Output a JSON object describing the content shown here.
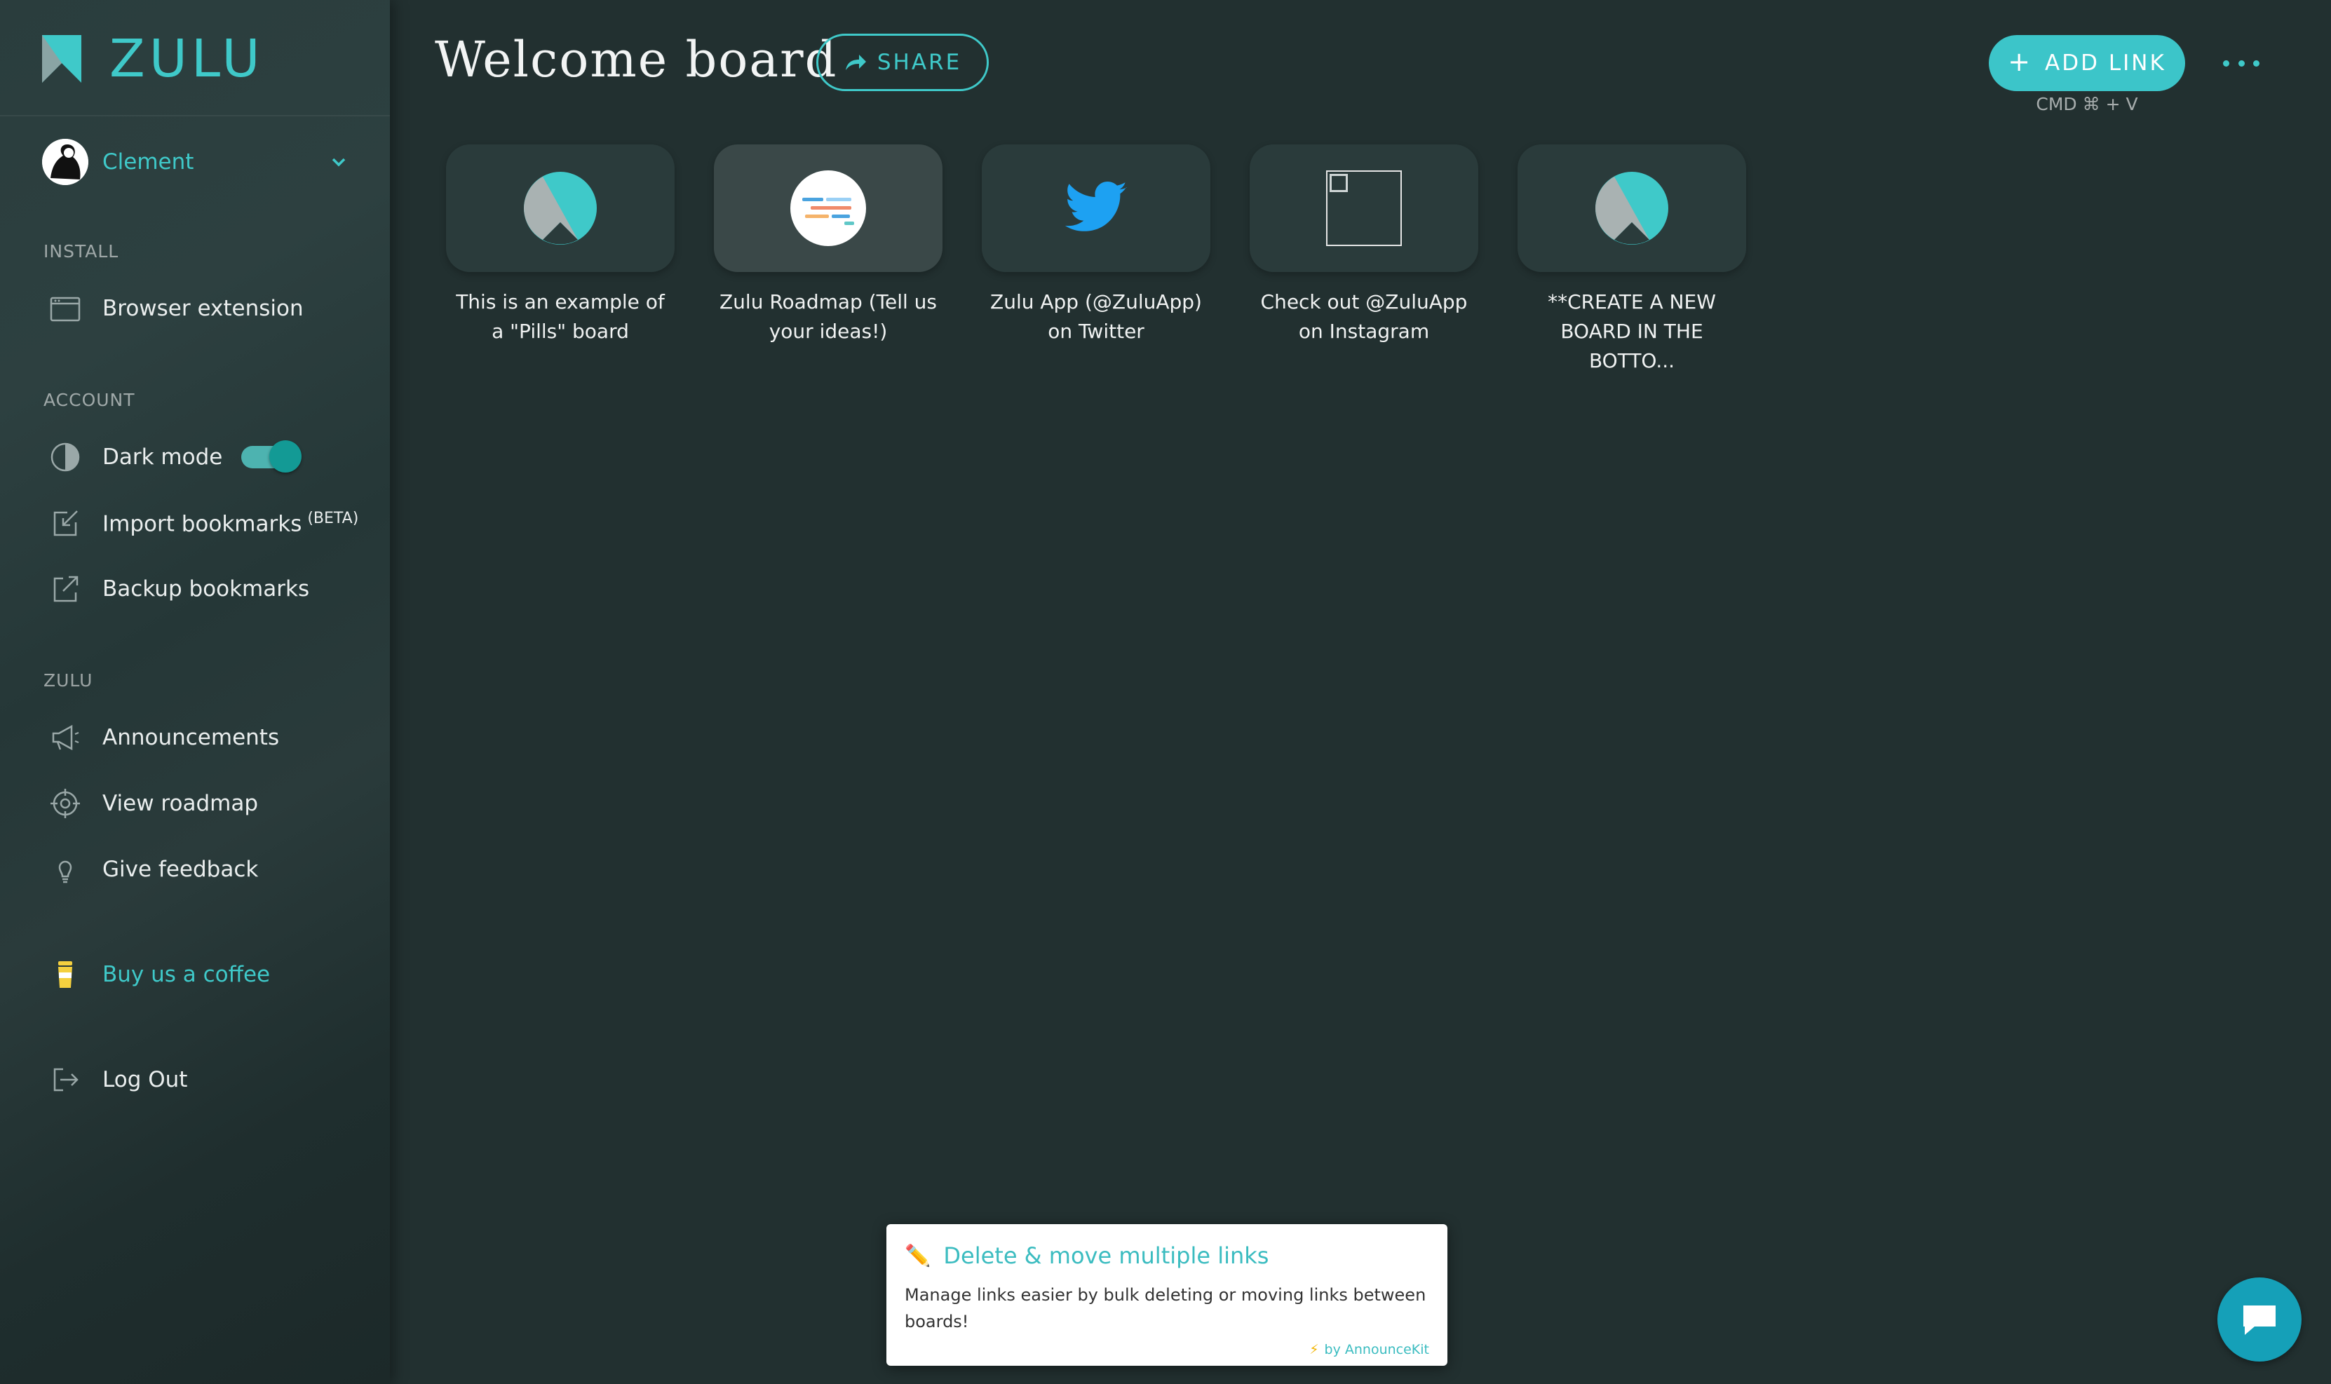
{
  "app": {
    "name": "ZULU",
    "accent": "#3fc9c9"
  },
  "user": {
    "name": "Clement"
  },
  "sidebar": {
    "install_heading": "INSTALL",
    "install_items": [
      {
        "label": "Browser extension",
        "icon": "browser-window-icon"
      }
    ],
    "account_heading": "ACCOUNT",
    "dark_mode": {
      "label": "Dark mode",
      "enabled": true
    },
    "import": {
      "label": "Import bookmarks",
      "badge": "(BETA)"
    },
    "backup": {
      "label": "Backup bookmarks"
    },
    "zulu_heading": "ZULU",
    "zulu_items": [
      {
        "label": "Announcements",
        "icon": "megaphone-icon"
      },
      {
        "label": "View roadmap",
        "icon": "crosshair-icon"
      },
      {
        "label": "Give feedback",
        "icon": "lightbulb-icon"
      }
    ],
    "coffee": {
      "label": "Buy us a coffee"
    },
    "logout": {
      "label": "Log Out"
    }
  },
  "header": {
    "board_title": "Welcome board",
    "share_label": "SHARE",
    "add_link_label": "ADD LINK",
    "add_link_shortcut": "CMD ⌘ + V"
  },
  "cards": [
    {
      "title": "This is an example of a \"Pills\" board",
      "icon": "zulu-logo-icon"
    },
    {
      "title": "Zulu Roadmap (Tell us your ideas!)",
      "icon": "roadmap-icon"
    },
    {
      "title": "Zulu App (@ZuluApp) on Twitter",
      "icon": "twitter-bird-icon"
    },
    {
      "title": "Check out @ZuluApp on Instagram",
      "icon": "broken-image-icon"
    },
    {
      "title": "**CREATE A NEW BOARD IN THE BOTTO...",
      "icon": "zulu-logo-icon"
    }
  ],
  "announcement": {
    "title": "Delete & move multiple links",
    "body": "Manage links easier by bulk deleting or moving links between boards!",
    "credit": "by AnnounceKit"
  }
}
